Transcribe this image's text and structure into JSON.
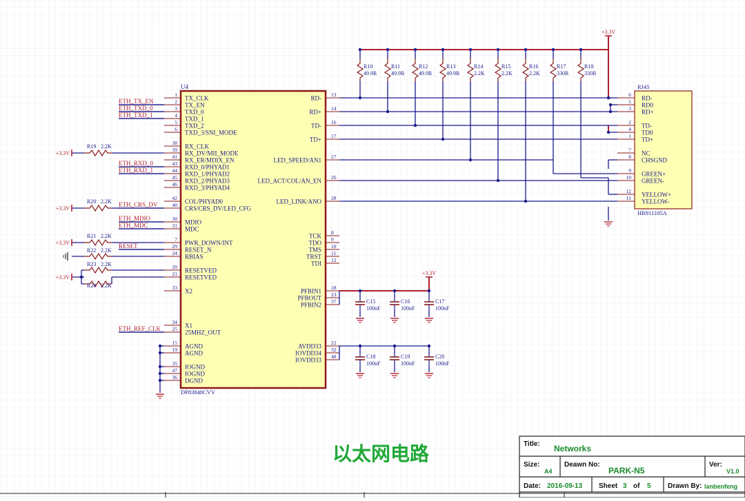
{
  "ic": {
    "ref": "U4",
    "part": "DP83848CVV",
    "left_pins": [
      {
        "num": "1",
        "name": "TX_CLK"
      },
      {
        "num": "2",
        "name": "TX_EN"
      },
      {
        "num": "3",
        "name": "TXD_0"
      },
      {
        "num": "4",
        "name": "TXD_1"
      },
      {
        "num": "5",
        "name": "TXD_2"
      },
      {
        "num": "6",
        "name": "TXD_3/SNI_MODE"
      },
      {
        "num": "38",
        "name": "RX_CLK"
      },
      {
        "num": "39",
        "name": "RX_DV/MII_MODE"
      },
      {
        "num": "41",
        "name": "RX_ER/MDIX_EN"
      },
      {
        "num": "43",
        "name": "RXD_0/PHYAD1"
      },
      {
        "num": "44",
        "name": "RXD_1/PHYAD2"
      },
      {
        "num": "45",
        "name": "RXD_2/PHYAD3"
      },
      {
        "num": "46",
        "name": "RXD_3/PHYAD4"
      },
      {
        "num": "42",
        "name": "COL/PHYAD0"
      },
      {
        "num": "40",
        "name": "CRS/CRS_DV/LED_CFG"
      },
      {
        "num": "30",
        "name": "MDIO"
      },
      {
        "num": "31",
        "name": "MDC"
      },
      {
        "num": "7",
        "name": "PWR_DOWN/INT"
      },
      {
        "num": "29",
        "name": "RESET_N"
      },
      {
        "num": "24",
        "name": "RBIAS"
      },
      {
        "num": "20",
        "name": "RESETVED"
      },
      {
        "num": "21",
        "name": "RESETVED"
      },
      {
        "num": "33",
        "name": "X2"
      },
      {
        "num": "34",
        "name": "X1"
      },
      {
        "num": "25",
        "name": "25MHZ_OUT"
      },
      {
        "num": "15",
        "name": "AGND"
      },
      {
        "num": "19",
        "name": "AGND"
      },
      {
        "num": "35",
        "name": "IOGND"
      },
      {
        "num": "47",
        "name": "IOGND"
      },
      {
        "num": "36",
        "name": "DGND"
      }
    ],
    "right_pins": [
      {
        "num": "13",
        "name": "RD-"
      },
      {
        "num": "14",
        "name": "RD+"
      },
      {
        "num": "16",
        "name": "TD-"
      },
      {
        "num": "17",
        "name": "TD+"
      },
      {
        "num": "27",
        "name": "LED_SPEED/AN1"
      },
      {
        "num": "26",
        "name": "LED_ACT/COL/AN_EN"
      },
      {
        "num": "28",
        "name": "LED_LINK/ANO"
      },
      {
        "num": "8",
        "name": "TCK"
      },
      {
        "num": "9",
        "name": "TDO"
      },
      {
        "num": "10",
        "name": "TMS"
      },
      {
        "num": "11",
        "name": "TRST"
      },
      {
        "num": "12",
        "name": "TDI"
      },
      {
        "num": "18",
        "name": "PFBIN1"
      },
      {
        "num": "23",
        "name": "PFBOUT"
      },
      {
        "num": "37",
        "name": "PFBIN2"
      },
      {
        "num": "22",
        "name": "AVDD33"
      },
      {
        "num": "32",
        "name": "IOVDD34"
      },
      {
        "num": "48",
        "name": "IOVDD33"
      }
    ]
  },
  "nets": [
    {
      "name": "ETH_TX_EN"
    },
    {
      "name": "ETH_TXD_0"
    },
    {
      "name": "ETH_TXD_1"
    },
    {
      "name": "ETH_RXD_0"
    },
    {
      "name": "ETH_RXD_1"
    },
    {
      "name": "ETH_CRS_DV"
    },
    {
      "name": "ETH_MDIO"
    },
    {
      "name": "ETH_MDC"
    },
    {
      "name": "RESET"
    },
    {
      "name": "ETH_REF_CLK"
    }
  ],
  "power": {
    "label": "+3.3V"
  },
  "left_resistors": [
    {
      "ref": "R19",
      "value": "2.2K"
    },
    {
      "ref": "R20",
      "value": "2.2K"
    },
    {
      "ref": "R21",
      "value": "2.2K"
    },
    {
      "ref": "R22",
      "value": "2.2K"
    },
    {
      "ref": "R23",
      "value": "2.2K"
    },
    {
      "ref": "R24",
      "value": "2.2K"
    }
  ],
  "top_resistors": [
    {
      "ref": "R10",
      "value": "49.9R"
    },
    {
      "ref": "R11",
      "value": "49.9R"
    },
    {
      "ref": "R12",
      "value": "49.9R"
    },
    {
      "ref": "R13",
      "value": "49.9R"
    },
    {
      "ref": "R14",
      "value": "2.2K"
    },
    {
      "ref": "R15",
      "value": "2.2K"
    },
    {
      "ref": "R16",
      "value": "2.2K"
    },
    {
      "ref": "R17",
      "value": "330R"
    },
    {
      "ref": "R18",
      "value": "330R"
    }
  ],
  "capacitors": [
    {
      "ref": "C15",
      "value": "100nF"
    },
    {
      "ref": "C16",
      "value": "100nF"
    },
    {
      "ref": "C17",
      "value": "100nF"
    },
    {
      "ref": "C18",
      "value": "100nF"
    },
    {
      "ref": "C19",
      "value": "100nF"
    },
    {
      "ref": "C20",
      "value": "100nF"
    }
  ],
  "rj45": {
    "ref": "RJ45",
    "part": "HR911105A",
    "pins": [
      {
        "num": "6",
        "name": "RD-"
      },
      {
        "num": "5",
        "name": "RD0"
      },
      {
        "num": "3",
        "name": "RD+"
      },
      {
        "num": "2",
        "name": "TD-"
      },
      {
        "num": "4",
        "name": "TD0"
      },
      {
        "num": "1",
        "name": "TD+"
      },
      {
        "num": "7",
        "name": "NC"
      },
      {
        "num": "8",
        "name": "CHSGND"
      },
      {
        "num": "9",
        "name": "GREEN+"
      },
      {
        "num": "10",
        "name": "GREEN-"
      },
      {
        "num": "12",
        "name": "YELLOW+"
      },
      {
        "num": "11",
        "name": "YELLOW-"
      }
    ]
  },
  "caption": "以太网电路",
  "title_block": {
    "title_label": "Title:",
    "title": "Networks",
    "size_label": "Size:",
    "size": "A4",
    "drawn_no_label": "Deawn No:",
    "drawn_no": "PARK-N5",
    "ver_label": "Ver:",
    "ver": "V1.0",
    "date_label": "Date:",
    "date": "2016-09-13",
    "sheet_label": "Sheet",
    "sheet": "3",
    "of_label": "of",
    "sheet_total": "5",
    "drawn_by_label": "Drawn By:",
    "drawn_by": "lanbenfeng"
  },
  "colors": {
    "grid": "#e2e2ee",
    "wire": "#1a1a8c",
    "part": "#8b1a1a",
    "ic_fill": "#ffffb4",
    "power": "#b0202c",
    "net_label": "#b0202c",
    "caption": "#20a838",
    "title_value": "#1a8a2c"
  }
}
